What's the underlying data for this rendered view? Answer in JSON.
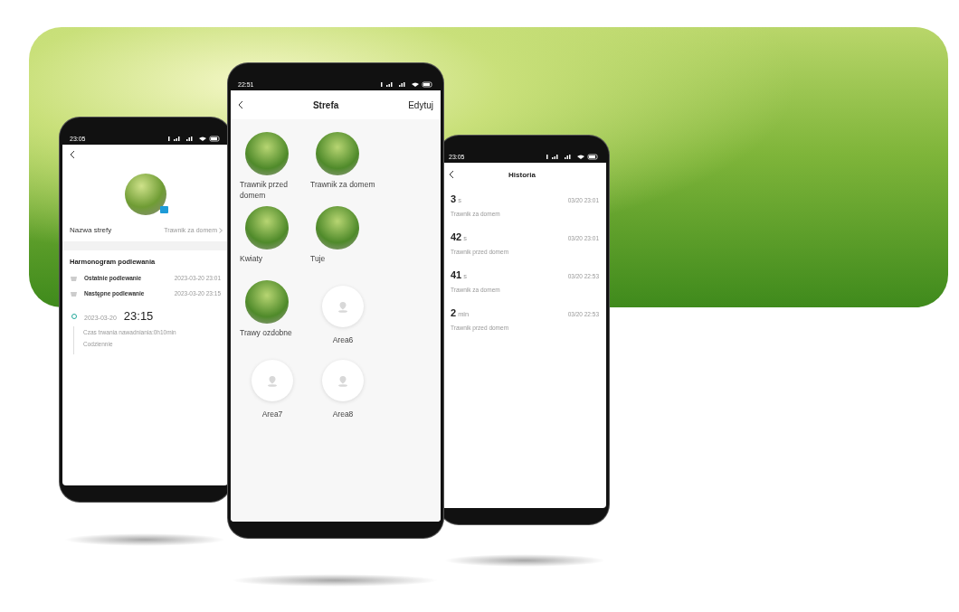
{
  "phones": [
    {
      "kind": "zone-detail",
      "status_time": "23:05",
      "zone_name_label": "Nazwa strefy",
      "zone_name_value": "Trawnik za domem",
      "schedule_title": "Harmonogram podlewania",
      "schedule_rows": [
        {
          "label": "Ostatnie podlewanie",
          "value": "2023-03-20 23:01"
        },
        {
          "label": "Następne podlewanie",
          "value": "2023-03-20 23:15"
        }
      ],
      "timeline": {
        "date": "2023-03-20",
        "time": "23:15",
        "duration": "Czas trwania nawadniania:0h10min",
        "repeat": "Codziennie"
      }
    },
    {
      "kind": "zones",
      "status_time": "22:51",
      "title": "Strefa",
      "action": "Edytuj",
      "zones": [
        {
          "name": "Trawnik przed domem",
          "photo": true
        },
        {
          "name": "Trawnik za domem",
          "photo": true
        },
        {
          "name": "Kwiaty",
          "photo": true
        },
        {
          "name": "Tuje",
          "photo": true
        },
        {
          "name": "Trawy ozdobne",
          "photo": true
        },
        {
          "name": "Area6",
          "photo": false
        },
        {
          "name": "Area7",
          "photo": false
        },
        {
          "name": "Area8",
          "photo": false
        }
      ]
    },
    {
      "kind": "history",
      "status_time": "23:05",
      "title": "Historia",
      "entries": [
        {
          "amount": "3",
          "unit": "s",
          "date": "03/20 23:01",
          "zone": "Trawnik za domem"
        },
        {
          "amount": "42",
          "unit": "s",
          "date": "03/20 23:01",
          "zone": "Trawnik przed domem"
        },
        {
          "amount": "41",
          "unit": "s",
          "date": "03/20 22:53",
          "zone": "Trawnik za domem"
        },
        {
          "amount": "2",
          "unit": "min",
          "date": "03/20 22:53",
          "zone": "Trawnik przed domem"
        }
      ]
    }
  ]
}
